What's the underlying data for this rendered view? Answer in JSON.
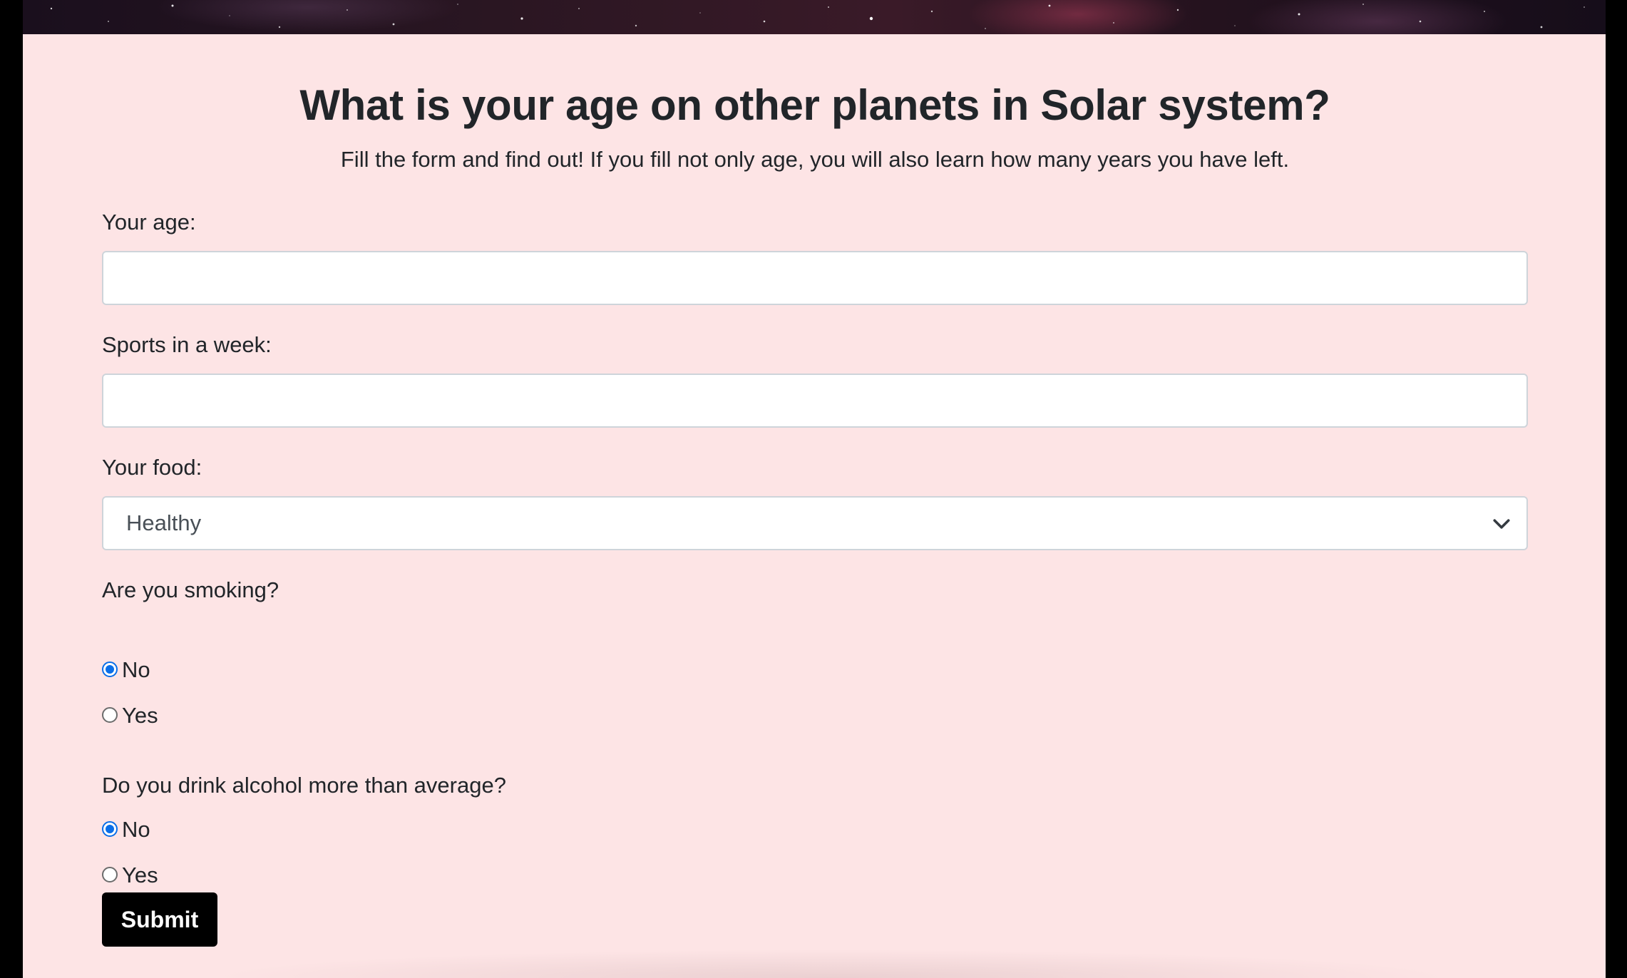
{
  "page": {
    "title": "What is your age on other planets in Solar system?",
    "subtitle": "Fill the form and find out! If you fill not only age, you will also learn how many years you have left."
  },
  "form": {
    "age": {
      "label": "Your age:",
      "value": "",
      "placeholder": ""
    },
    "sports": {
      "label": "Sports in a week:",
      "value": "",
      "placeholder": ""
    },
    "food": {
      "label": "Your food:",
      "selected": "Healthy"
    },
    "smoking": {
      "label": "Are you smoking?",
      "options": [
        {
          "label": "No",
          "checked": true
        },
        {
          "label": "Yes",
          "checked": false
        }
      ]
    },
    "alcohol": {
      "label": "Do you drink alcohol more than average?",
      "options": [
        {
          "label": "No",
          "checked": true
        },
        {
          "label": "Yes",
          "checked": false
        }
      ]
    },
    "submit_label": "Submit"
  },
  "colors": {
    "panel_bg": "#fde4e5",
    "radio_accent": "#0a6ee8",
    "submit_bg": "#000000"
  },
  "icons": {
    "select_arrow": "chevron-down-icon"
  }
}
